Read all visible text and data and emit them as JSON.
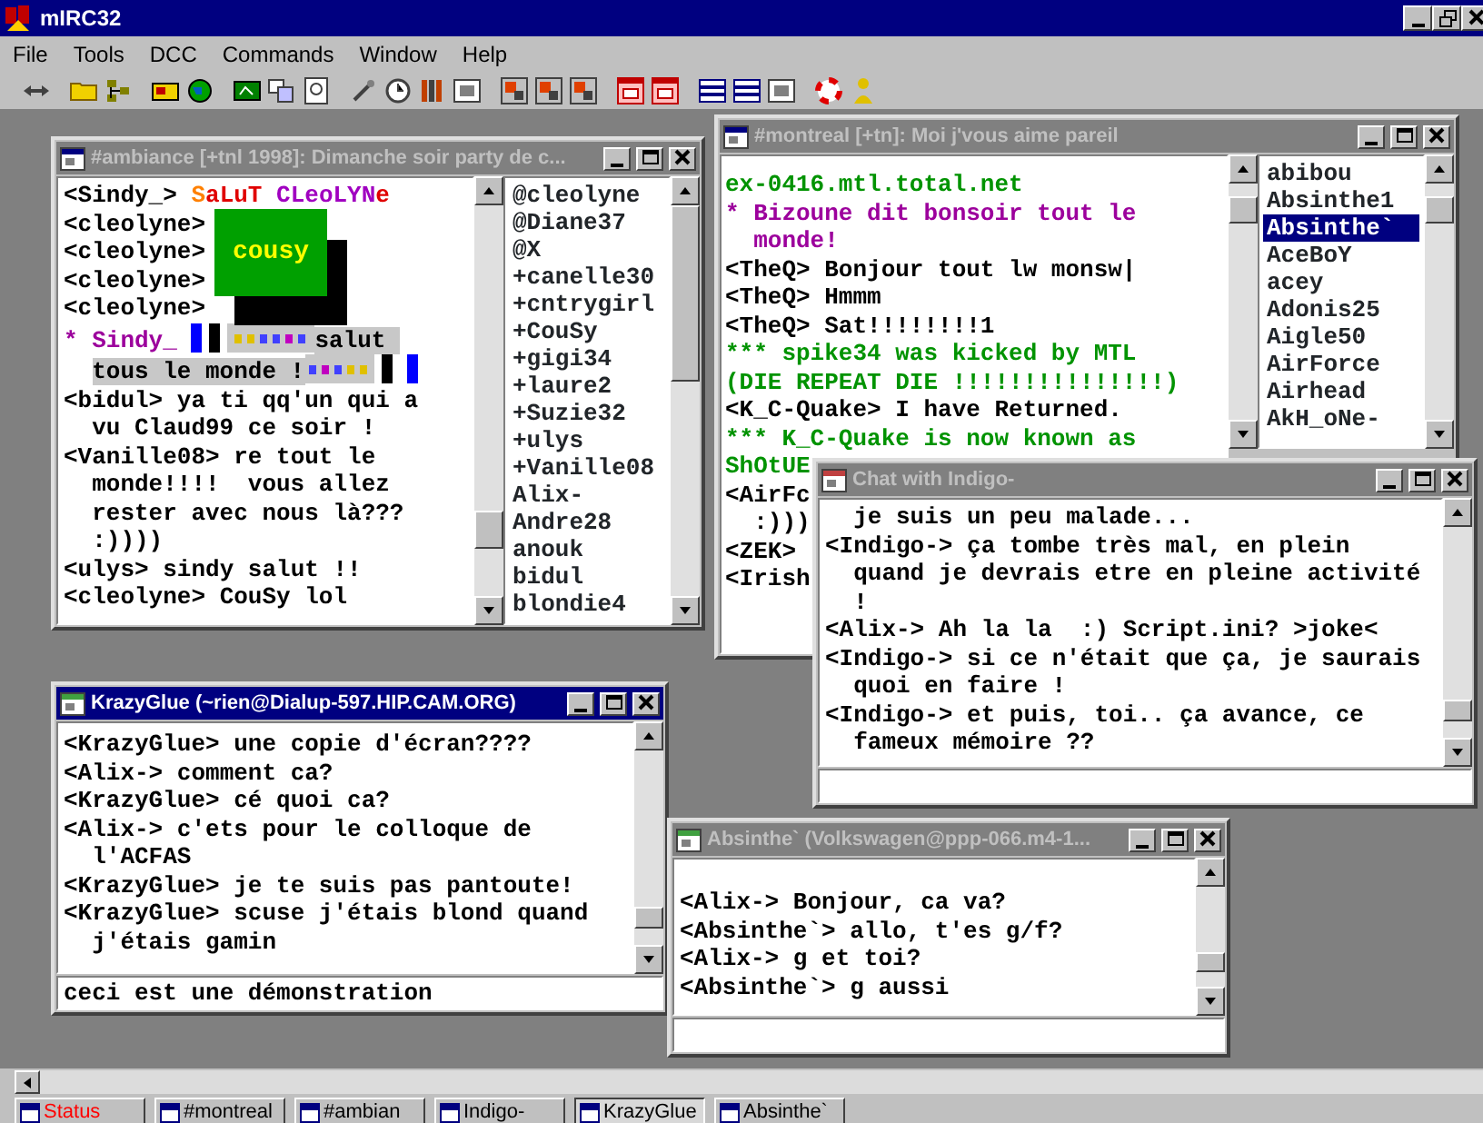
{
  "app": {
    "title": "mIRC32"
  },
  "menu": [
    "File",
    "Tools",
    "DCC",
    "Commands",
    "Window",
    "Help"
  ],
  "windows": [
    {
      "kind": "channel",
      "title": "#ambiance [+tnl 1998]: Dimanche soir party de c...",
      "active": false,
      "art": {
        "text": "cousy"
      },
      "lines": [
        {
          "kind": "colored",
          "segments": [
            {
              "text": "<Sindy_> ",
              "color": "#000000"
            },
            {
              "text": "S",
              "color": "#ff8000"
            },
            {
              "text": "aLuT ",
              "color": "#e00000"
            },
            {
              "text": "CLeoLYN",
              "color": "#a000c0"
            },
            {
              "text": "e",
              "color": "#e00000"
            }
          ]
        },
        {
          "kind": "message",
          "text": "<cleolyne>"
        },
        {
          "kind": "message",
          "text": "<cleolyne>"
        },
        {
          "kind": "message",
          "text": "<cleolyne>"
        },
        {
          "kind": "message",
          "text": "<cleolyne>"
        },
        {
          "kind": "action-art",
          "nick": "* Sindy_",
          "text": "salut tous le monde !"
        },
        {
          "kind": "message",
          "text": "<bidul> ya ti qq'un qui a vu Claud99 ce soir !"
        },
        {
          "kind": "message",
          "text": "<Vanille08> re tout le monde!!!!  vous allez rester avec nous là??? :))))"
        },
        {
          "kind": "message",
          "text": "<ulys> sindy salut !!"
        },
        {
          "kind": "message",
          "text": "<cleolyne> CouSy lol"
        }
      ],
      "nicklist": [
        {
          "name": "@cleolyne",
          "selected": false
        },
        {
          "name": "@Diane37",
          "selected": false
        },
        {
          "name": "@X",
          "selected": false
        },
        {
          "name": "+canelle30",
          "selected": false
        },
        {
          "name": "+cntrygirl",
          "selected": false
        },
        {
          "name": "+CouSy",
          "selected": false
        },
        {
          "name": "+gigi34",
          "selected": false
        },
        {
          "name": "+laure2",
          "selected": false
        },
        {
          "name": "+Suzie32",
          "selected": false
        },
        {
          "name": "+ulys",
          "selected": false
        },
        {
          "name": "+Vanille08",
          "selected": false
        },
        {
          "name": "Alix-",
          "selected": false
        },
        {
          "name": "Andre28",
          "selected": false
        },
        {
          "name": "anouk",
          "selected": false
        },
        {
          "name": "bidul",
          "selected": false
        },
        {
          "name": "blondie4",
          "selected": false
        }
      ]
    },
    {
      "kind": "channel",
      "title": "#montreal [+tn]: Moi j'vous aime pareil",
      "active": false,
      "lines": [
        {
          "kind": "event",
          "text": "ex-0416.mtl.total.net"
        },
        {
          "kind": "action",
          "text": "* Bizoune dit bonsoir tout le monde!"
        },
        {
          "kind": "message",
          "text": "<TheQ> Bonjour tout lw monsw|"
        },
        {
          "kind": "message",
          "text": "<TheQ> Hmmm"
        },
        {
          "kind": "message",
          "text": "<TheQ> Sat!!!!!!!!1"
        },
        {
          "kind": "event",
          "text": "*** spike34 was kicked by MTL"
        },
        {
          "kind": "event",
          "text": "(DIE REPEAT DIE !!!!!!!!!!!!!!!)"
        },
        {
          "kind": "message",
          "text": "<K_C-Quake> I have Returned."
        },
        {
          "kind": "event",
          "text": "*** K_C-Quake is now known as"
        },
        {
          "kind": "event",
          "text": "ShOtUE"
        },
        {
          "kind": "message",
          "text": "<AirFc"
        },
        {
          "kind": "continued",
          "text": ":)))"
        },
        {
          "kind": "message",
          "text": "<ZEK>"
        },
        {
          "kind": "message",
          "text": "<Irish"
        }
      ],
      "nicklist": [
        {
          "name": "abibou",
          "selected": false
        },
        {
          "name": "Absinthe1",
          "selected": false
        },
        {
          "name": "Absinthe`",
          "selected": true
        },
        {
          "name": "AceBoY",
          "selected": false
        },
        {
          "name": "acey",
          "selected": false
        },
        {
          "name": "Adonis25",
          "selected": false
        },
        {
          "name": "Aigle50",
          "selected": false
        },
        {
          "name": "AirForce",
          "selected": false
        },
        {
          "name": "Airhead",
          "selected": false
        },
        {
          "name": "AkH_oNe-",
          "selected": false
        }
      ]
    },
    {
      "kind": "chat",
      "title": "Chat with Indigo-",
      "active": false,
      "lines": [
        {
          "kind": "continued",
          "text": "je suis un peu malade..."
        },
        {
          "kind": "message",
          "text": "<Indigo-> ça tombe très mal, en plein quand je devrais etre en pleine activité !"
        },
        {
          "kind": "message",
          "text": "<Alix-> Ah la la  :) Script.ini? >joke<"
        },
        {
          "kind": "message",
          "text": "<Indigo-> si ce n'était que ça, je saurais quoi en faire !"
        },
        {
          "kind": "message",
          "text": "<Indigo-> et puis, toi.. ça avance, ce fameux mémoire ??"
        }
      ]
    },
    {
      "kind": "query",
      "title": "KrazyGlue (~rien@Dialup-597.HIP.CAM.ORG)",
      "active": true,
      "lines": [
        {
          "kind": "message",
          "text": "<KrazyGlue> une copie d'écran????"
        },
        {
          "kind": "message",
          "text": "<Alix-> comment ca?"
        },
        {
          "kind": "message",
          "text": "<KrazyGlue> cé quoi ca?"
        },
        {
          "kind": "message",
          "text": "<Alix-> c'ets pour le colloque de l'ACFAS"
        },
        {
          "kind": "message",
          "text": "<KrazyGlue> je te suis pas pantoute!"
        },
        {
          "kind": "message",
          "text": "<KrazyGlue> scuse j'étais blond quand j'étais gamin"
        }
      ],
      "input": {
        "value": "ceci est une démonstration"
      }
    },
    {
      "kind": "query",
      "title": "Absinthe` (Volkswagen@ppp-066.m4-1...",
      "active": false,
      "lines": [
        {
          "kind": "message",
          "text": "<Alix-> Bonjour, ca va?"
        },
        {
          "kind": "message",
          "text": "<Absinthe`> allo, t'es g/f?"
        },
        {
          "kind": "message",
          "text": "<Alix-> g et toi?"
        },
        {
          "kind": "message",
          "text": "<Absinthe`> g aussi"
        }
      ]
    }
  ],
  "switchbar": [
    {
      "label": "Status",
      "selected": false,
      "color": "#ff0000"
    },
    {
      "label": "#montreal",
      "selected": false,
      "color": "#000000"
    },
    {
      "label": "#ambian",
      "selected": false,
      "color": "#000000"
    },
    {
      "label": "Indigo-",
      "selected": false,
      "color": "#000000"
    },
    {
      "label": "KrazyGlue",
      "selected": true,
      "color": "#000000"
    },
    {
      "label": "Absinthe`",
      "selected": false,
      "color": "#000000"
    }
  ]
}
